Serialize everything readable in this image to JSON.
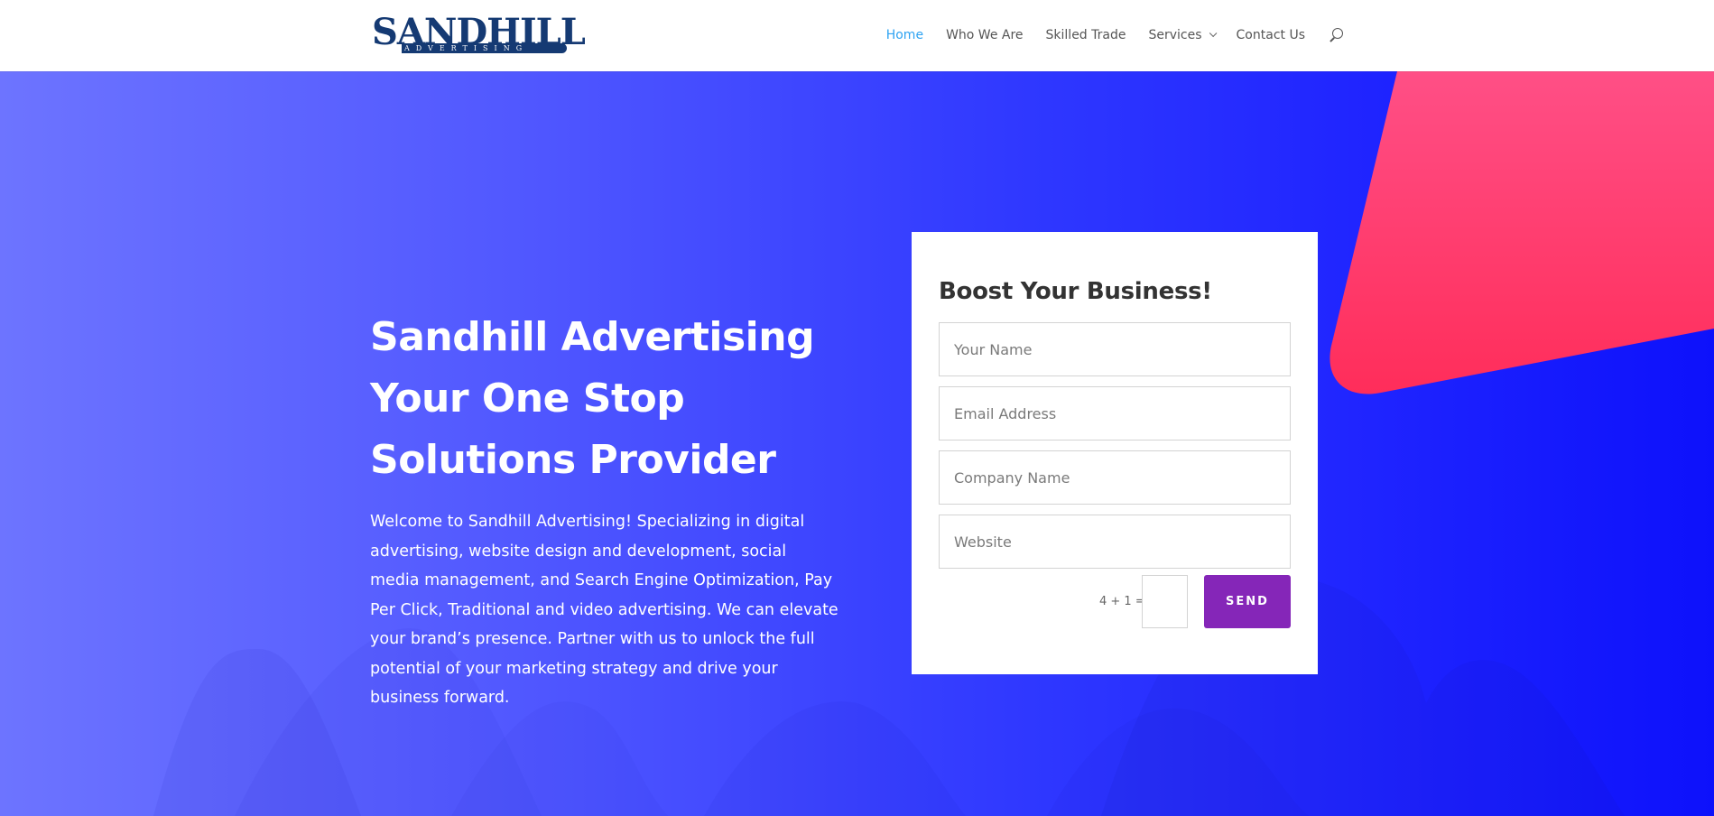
{
  "header": {
    "logo": {
      "name": "SANDHILL",
      "tagline": "ADVERTISING"
    },
    "nav": [
      {
        "label": "Home",
        "active": true
      },
      {
        "label": "Who We Are",
        "active": false
      },
      {
        "label": "Skilled Trade",
        "active": false
      },
      {
        "label": "Services",
        "active": false,
        "has_dropdown": true
      },
      {
        "label": "Contact Us",
        "active": false
      }
    ],
    "search_icon": "search-icon"
  },
  "hero": {
    "title_lines": [
      "Sandhill Advertising",
      "Your One Stop",
      "Solutions Provider"
    ],
    "body": "Welcome to Sandhill Advertising! Specializing in digital advertising, website design and  development, social media management, and Search Engine Optimization, Pay Per Click, Traditional and video advertising. We can elevate your brand’s presence. Partner with us to unlock the full potential of your marketing strategy and drive your business forward."
  },
  "form": {
    "title": "Boost Your Business!",
    "fields": [
      {
        "placeholder": "Your Name",
        "value": ""
      },
      {
        "placeholder": "Email Address",
        "value": ""
      },
      {
        "placeholder": "Company Name",
        "value": ""
      },
      {
        "placeholder": "Website",
        "value": ""
      }
    ],
    "captcha_question": "4 + 1 =",
    "captcha_value": "",
    "submit_label": "SEND"
  },
  "colors": {
    "nav_active": "#2ea3f2",
    "nav_text": "#555555",
    "hero_gradient_start": "#6d74ff",
    "hero_gradient_end": "#0d11fb",
    "accent_shape": "#ff3d6e",
    "send_button": "#8526b8",
    "logo_blue": "#153a73"
  }
}
